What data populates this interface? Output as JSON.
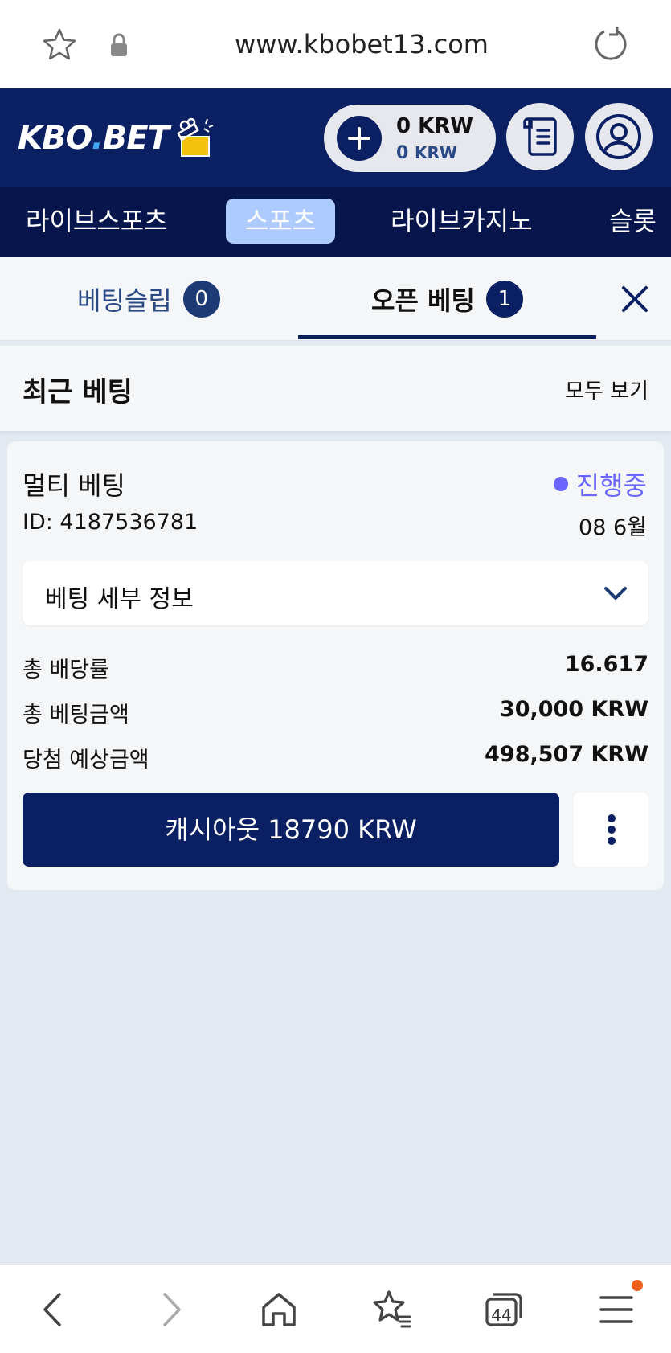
{
  "browser": {
    "url": "www.kbobet13.com",
    "tabs_count": "44",
    "notification_color": "#f0601d"
  },
  "header": {
    "logo_text_main": "KBO",
    "logo_text_dot": ".",
    "logo_text_tail": "BET",
    "balance_primary": "0 KRW",
    "balance_secondary_amount": "0",
    "balance_secondary_unit": "KRW",
    "brand_color": "#0b1f63"
  },
  "nav": {
    "items": [
      {
        "label": "라이브스포츠"
      },
      {
        "label": "스포츠",
        "active": true
      },
      {
        "label": "라이브카지노"
      },
      {
        "label": "슬롯"
      }
    ]
  },
  "tabs": {
    "slip_label": "베팅슬립",
    "slip_count": "0",
    "open_label": "오픈 베팅",
    "open_count": "1"
  },
  "recent": {
    "title": "최근 베팅",
    "view_all": "모두 보기"
  },
  "bet": {
    "type": "멀티 베팅",
    "status": "진행중",
    "status_color": "#6b66ff",
    "id": "ID: 4187536781",
    "date": "08 6월",
    "details_label": "베팅 세부 정보",
    "rows": [
      {
        "key": "총 배당률",
        "value": "16.617"
      },
      {
        "key": "총 베팅금액",
        "value": "30,000 KRW"
      },
      {
        "key": "당첨 예상금액",
        "value": "498,507 KRW"
      }
    ],
    "cashout_label": "캐시아웃 18790 KRW"
  }
}
